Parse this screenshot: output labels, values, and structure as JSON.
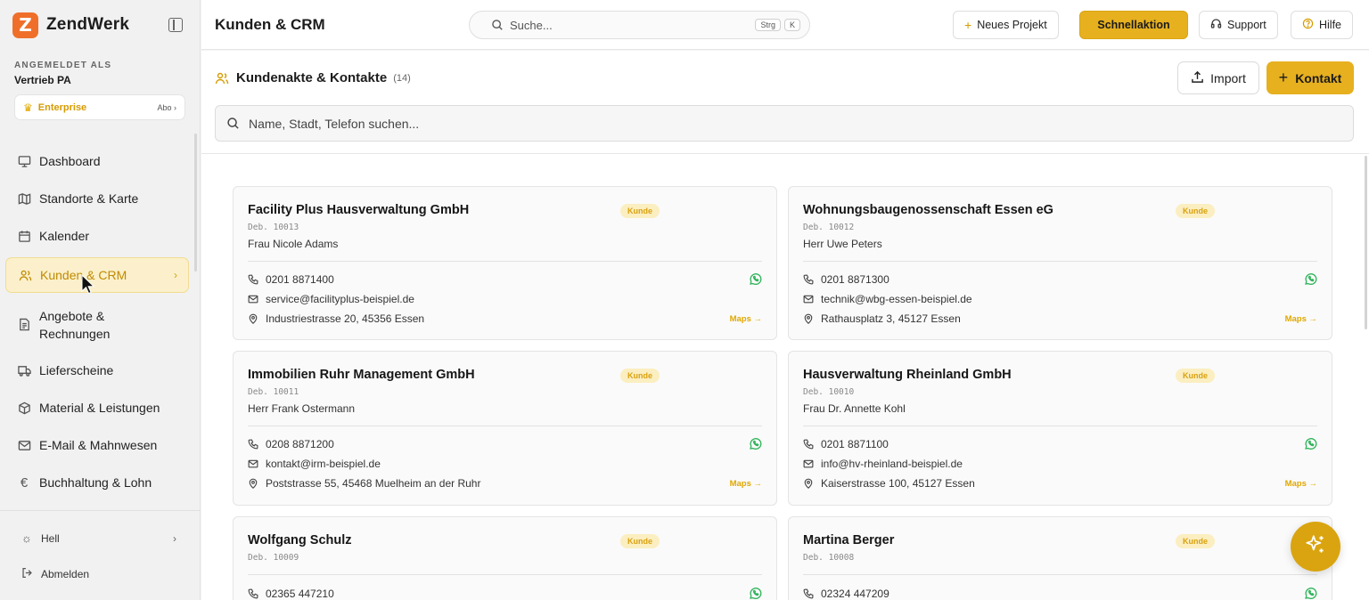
{
  "app": {
    "name": "ZendWerk",
    "logo_letter": "Z"
  },
  "user": {
    "caption": "ANGEMELDET ALS",
    "name": "Vertrieb PA",
    "plan": "Enterprise",
    "plan_link": "Abo ›"
  },
  "nav": [
    {
      "label": "Dashboard",
      "icon": "monitor-icon"
    },
    {
      "label": "Standorte & Karte",
      "icon": "map-icon"
    },
    {
      "label": "Kalender",
      "icon": "calendar-icon"
    },
    {
      "label": "Kunden & CRM",
      "icon": "users-icon",
      "active": true
    },
    {
      "label": "Angebote & Rechnungen",
      "icon": "document-icon"
    },
    {
      "label": "Lieferscheine",
      "icon": "truck-icon"
    },
    {
      "label": "Material & Leistungen",
      "icon": "package-icon"
    },
    {
      "label": "E-Mail & Mahnwesen",
      "icon": "mail-icon"
    },
    {
      "label": "Buchhaltung & Lohn",
      "icon": "euro-icon"
    }
  ],
  "bottom": {
    "theme": "Hell",
    "logout": "Abmelden"
  },
  "topbar": {
    "title": "Kunden & CRM",
    "search_placeholder": "Suche...",
    "kbd1": "Strg",
    "kbd2": "K",
    "new_project": "Neues Projekt",
    "quick_action": "Schnellaktion",
    "support": "Support",
    "help": "Hilfe"
  },
  "panel": {
    "title": "Kundenakte & Kontakte",
    "count": "(14)",
    "import": "Import",
    "contact": "Kontakt",
    "search_placeholder": "Name, Stadt, Telefon suchen..."
  },
  "colors": {
    "accent": "#e6b01f",
    "brand": "#ef6f2a",
    "whatsapp": "#2fb35a"
  },
  "cards": [
    {
      "name": "Facility Plus Hausverwaltung GmbH",
      "badge": "Kunde",
      "deb": "Deb. 10013",
      "contact": "Frau Nicole Adams",
      "phone": "0201 8871400",
      "email": "service@facilityplus-beispiel.de",
      "address": "Industriestrasse 20, 45356 Essen",
      "maps": "Maps →"
    },
    {
      "name": "Wohnungsbaugenossenschaft Essen eG",
      "badge": "Kunde",
      "deb": "Deb. 10012",
      "contact": "Herr Uwe Peters",
      "phone": "0201 8871300",
      "email": "technik@wbg-essen-beispiel.de",
      "address": "Rathausplatz 3, 45127 Essen",
      "maps": "Maps →"
    },
    {
      "name": "Immobilien Ruhr Management GmbH",
      "badge": "Kunde",
      "deb": "Deb. 10011",
      "contact": "Herr Frank Ostermann",
      "phone": "0208 8871200",
      "email": "kontakt@irm-beispiel.de",
      "address": "Poststrasse 55, 45468 Muelheim an der Ruhr",
      "maps": "Maps →"
    },
    {
      "name": "Hausverwaltung Rheinland GmbH",
      "badge": "Kunde",
      "deb": "Deb. 10010",
      "contact": "Frau Dr. Annette Kohl",
      "phone": "0201 8871100",
      "email": "info@hv-rheinland-beispiel.de",
      "address": "Kaiserstrasse 100, 45127 Essen",
      "maps": "Maps →"
    },
    {
      "name": "Wolfgang Schulz",
      "badge": "Kunde",
      "deb": "Deb. 10009",
      "phone": "02365 447210"
    },
    {
      "name": "Martina Berger",
      "badge": "Kunde",
      "deb": "Deb. 10008",
      "phone": "02324 447209"
    }
  ]
}
